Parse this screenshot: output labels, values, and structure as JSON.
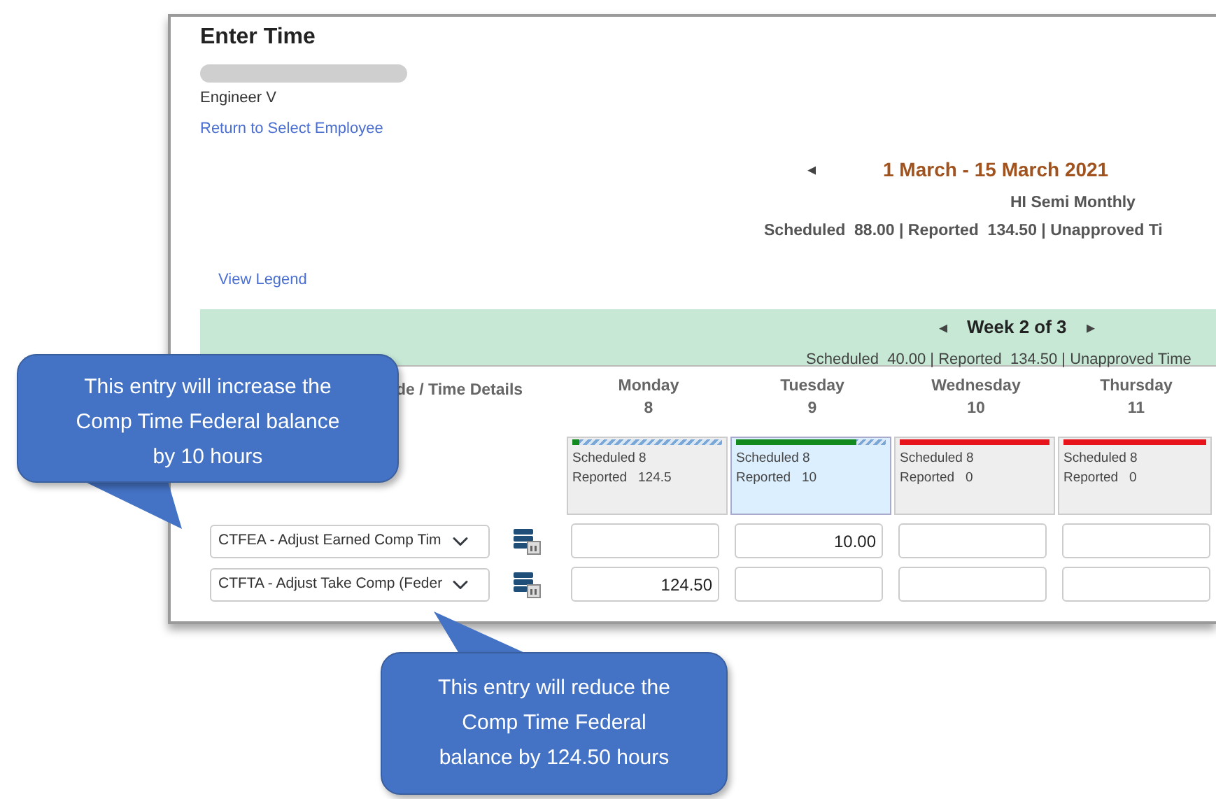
{
  "page": {
    "title": "Enter Time",
    "job_title": "Engineer V",
    "return_link": "Return to Select Employee",
    "legend_link": "View Legend"
  },
  "period": {
    "prev": "◂",
    "title": "1 March - 15 March 2021",
    "schedule": "HI Semi Monthly",
    "summary": "Scheduled  88.00 | Reported  134.50 | Unapproved Ti"
  },
  "week": {
    "prev": "◂",
    "title": "Week 2 of 3",
    "next": "▸",
    "summary": "Scheduled  40.00 | Reported  134.50 | Unapproved Time"
  },
  "grid": {
    "column_1": "de / Time Details",
    "days": [
      {
        "name": "Monday",
        "date": "8",
        "scheduled": "Scheduled 8",
        "reported": "Reported   124.5",
        "selected": false,
        "color": "#138a1e",
        "level": 0.05
      },
      {
        "name": "Tuesday",
        "date": "9",
        "scheduled": "Scheduled 8",
        "reported": "Reported   10",
        "selected": true,
        "color": "#138a1e",
        "level": 0.8
      },
      {
        "name": "Wednesday",
        "date": "10",
        "scheduled": "Scheduled 8",
        "reported": "Reported   0",
        "selected": false,
        "color": "#e8141b",
        "level": 1
      },
      {
        "name": "Thursday",
        "date": "11",
        "scheduled": "Scheduled 8",
        "reported": "Reported   0",
        "selected": false,
        "color": "#e8141b",
        "level": 1
      }
    ],
    "rows": [
      {
        "time_code": "CTFEA - Adjust Earned Comp Tim",
        "hours": {
          "day_2": "10.00"
        }
      },
      {
        "time_code": "CTFTA - Adjust Take Comp (Feder",
        "hours": {
          "day_1": "124.50"
        }
      }
    ]
  },
  "callouts": [
    {
      "text": "This entry will increase the Comp Time Federal balance by 10 hours",
      "kind": "down"
    },
    {
      "text": "This entry will reduce the Comp Time Federal balance by 124.50  hours",
      "kind": "up"
    }
  ]
}
